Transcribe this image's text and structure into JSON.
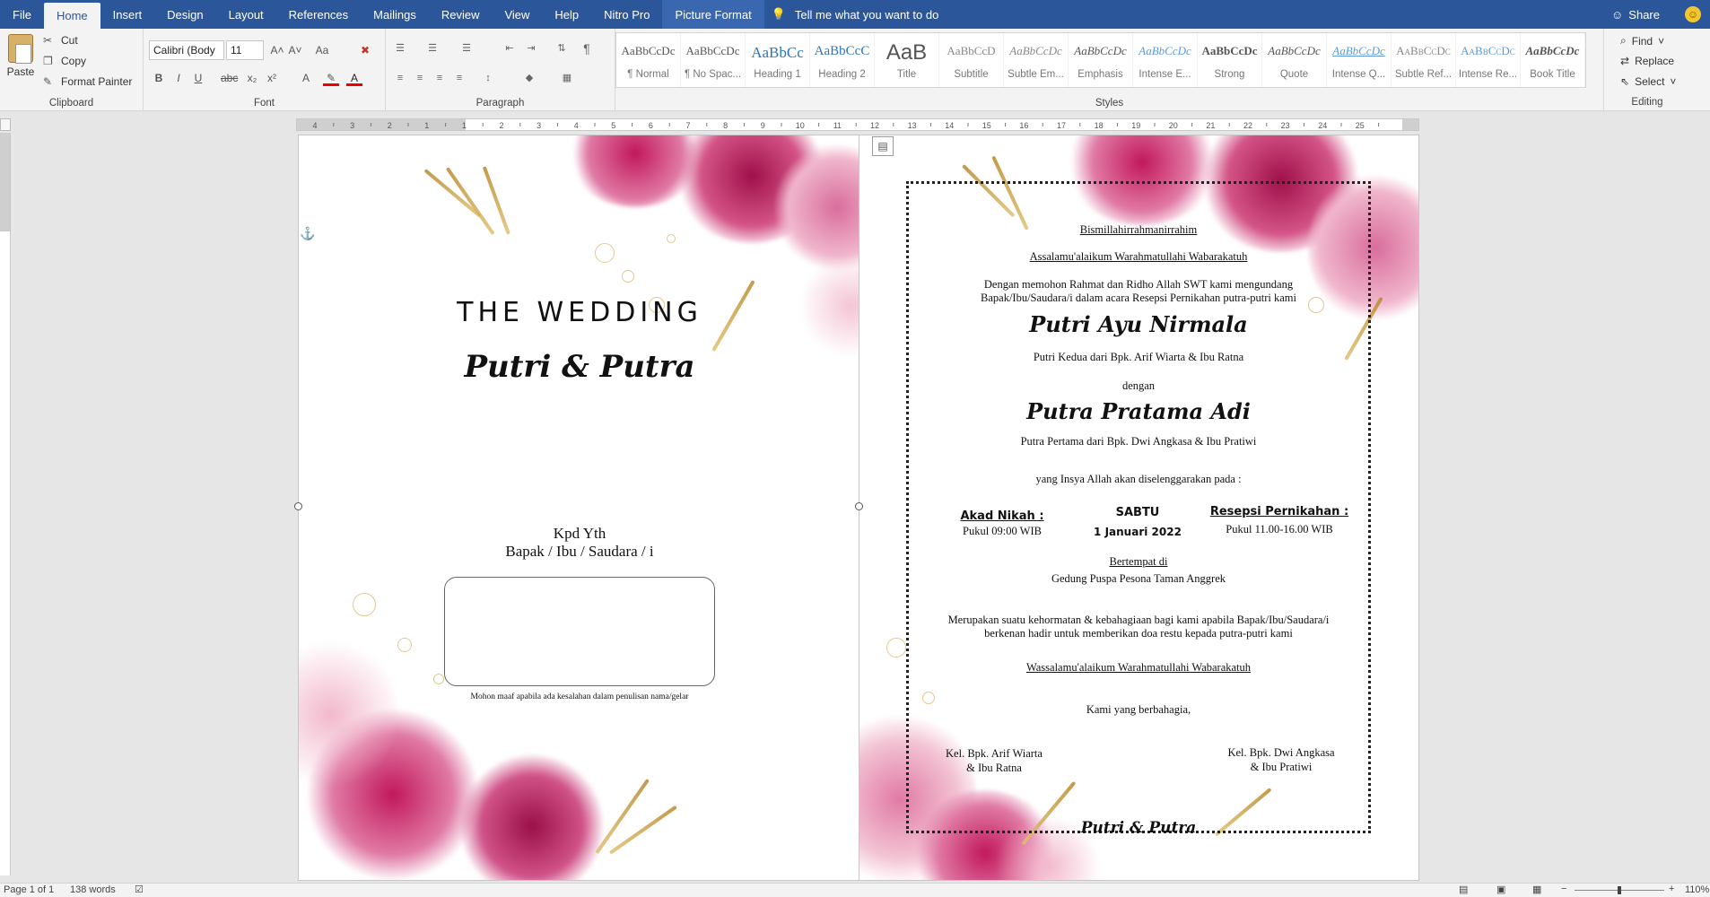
{
  "ribbon_tabs": [
    "File",
    "Home",
    "Insert",
    "Design",
    "Layout",
    "References",
    "Mailings",
    "Review",
    "View",
    "Help",
    "Nitro Pro",
    "Picture Format"
  ],
  "tell_me": "Tell me what you want to do",
  "share": "Share",
  "clipboard": {
    "paste": "Paste",
    "cut": "Cut",
    "copy": "Copy",
    "format_painter": "Format Painter",
    "label": "Clipboard"
  },
  "font": {
    "name": "Calibri (Body",
    "size": "11",
    "label": "Font"
  },
  "paragraph": {
    "label": "Paragraph"
  },
  "styles": {
    "label": "Styles",
    "items": [
      {
        "preview": "AaBbCcDc",
        "name": "¶ Normal"
      },
      {
        "preview": "AaBbCcDc",
        "name": "¶ No Spac..."
      },
      {
        "preview": "AaBbCc",
        "name": "Heading 1"
      },
      {
        "preview": "AaBbCcC",
        "name": "Heading 2"
      },
      {
        "preview": "AaB",
        "name": "Title"
      },
      {
        "preview": "AaBbCcD",
        "name": "Subtitle"
      },
      {
        "preview": "AaBbCcDc",
        "name": "Subtle Em..."
      },
      {
        "preview": "AaBbCcDc",
        "name": "Emphasis"
      },
      {
        "preview": "AaBbCcDc",
        "name": "Intense E..."
      },
      {
        "preview": "AaBbCcDc",
        "name": "Strong"
      },
      {
        "preview": "AaBbCcDc",
        "name": "Quote"
      },
      {
        "preview": "AaBbCcDc",
        "name": "Intense Q..."
      },
      {
        "preview": "AaBbCcDc",
        "name": "Subtle Ref..."
      },
      {
        "preview": "AaBbCcDc",
        "name": "Intense Re..."
      },
      {
        "preview": "AaBbCcDc",
        "name": "Book Title"
      }
    ]
  },
  "editing": {
    "find": "Find",
    "replace": "Replace",
    "select": "Select",
    "label": "Editing"
  },
  "ruler_numbers": [
    "4",
    "3",
    "2",
    "1",
    "1",
    "2",
    "3",
    "4",
    "5",
    "6",
    "7",
    "8",
    "9",
    "10",
    "11",
    "12",
    "13",
    "14",
    "15",
    "16",
    "17",
    "18",
    "19",
    "20",
    "21",
    "22",
    "23",
    "24",
    "25"
  ],
  "page1": {
    "title": "THE WEDDING",
    "names": "Putri & Putra",
    "kpd": "Kpd Yth",
    "recipient": "Bapak / Ibu / Saudara / i",
    "note": "Mohon maaf apabila ada kesalahan dalam penulisan nama/gelar"
  },
  "page2": {
    "bismillah": "Bismillahirrahmanirrahim",
    "salam": "Assalamu'alaikum Warahmatullahi Wabarakatuh",
    "intro1": "Dengan memohon Rahmat dan Ridho Allah SWT kami mengundang",
    "intro2": "Bapak/Ibu/Saudara/i dalam acara Resepsi Pernikahan putra-putri kami",
    "bride": "Putri Ayu Nirmala",
    "bride_parents": "Putri Kedua dari Bpk. Arif Wiarta & Ibu Ratna",
    "dengan": "dengan",
    "groom": "Putra Pratama Adi",
    "groom_parents": "Putra Pertama dari Bpk. Dwi Angkasa & Ibu Pratiwi",
    "insya": "yang Insya Allah akan diselenggarakan pada :",
    "akad_label": "Akad Nikah :",
    "akad_time": "Pukul 09:00 WIB",
    "day": "SABTU",
    "date": "1 Januari 2022",
    "resepsi_label": "Resepsi Pernikahan :",
    "resepsi_time": "Pukul 11.00-16.00 WIB",
    "bertempat": "Bertempat di",
    "venue": "Gedung Puspa Pesona Taman Anggrek",
    "honor1": "Merupakan suatu kehormatan & kebahagiaan bagi kami apabila Bapak/Ibu/Saudara/i",
    "honor2": "berkenan hadir untuk memberikan doa restu kepada putra-putri kami",
    "closing": "Wassalamu'alaikum Warahmatullahi Wabarakatuh",
    "happy": "Kami yang berbahagia,",
    "fam1_a": "Kel. Bpk. Arif Wiarta",
    "fam1_b": "& Ibu Ratna",
    "fam2_a": "Kel. Bpk. Dwi Angkasa",
    "fam2_b": "& Ibu Pratiwi",
    "footer_names": "Putri & Putra"
  },
  "status": {
    "page": "Page 1 of 1",
    "words": "138 words",
    "zoom": "110%"
  },
  "colors": {
    "word_blue": "#2b579a",
    "rose": "#c2185b",
    "gold": "#c9a24a"
  }
}
